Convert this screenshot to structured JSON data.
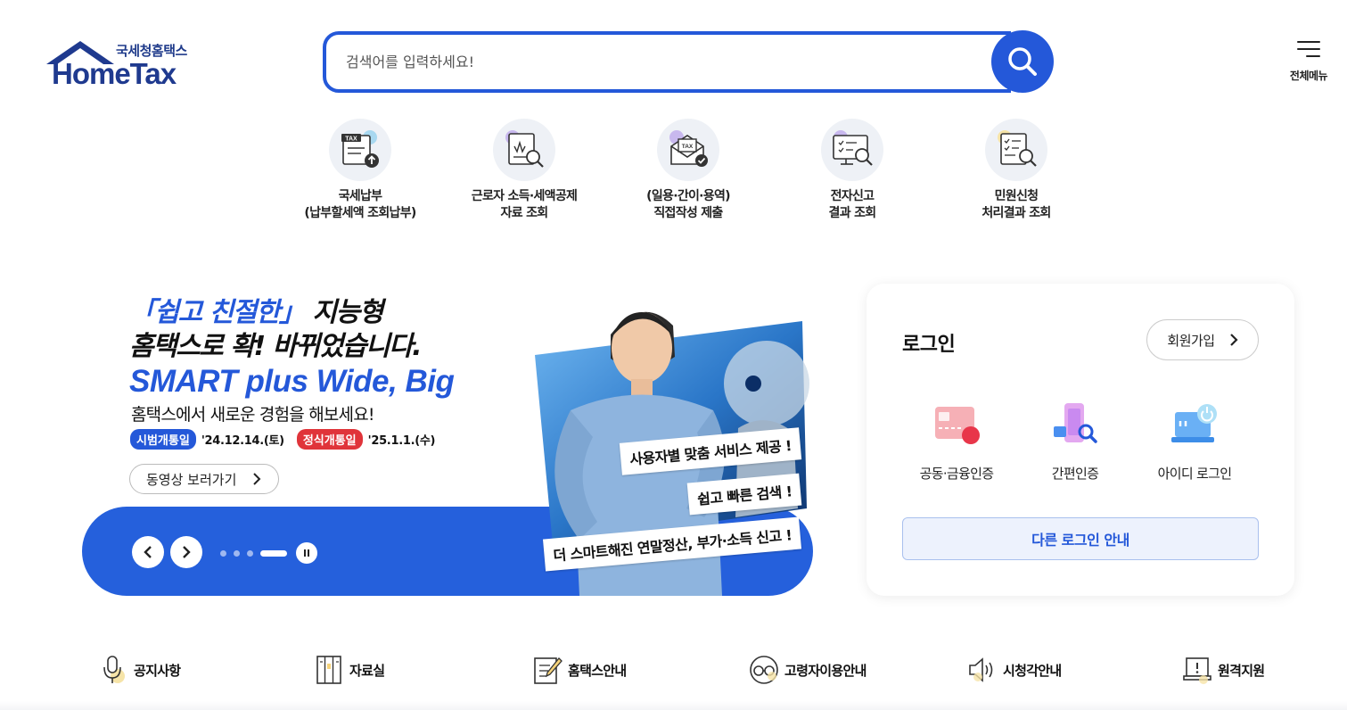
{
  "header": {
    "logo_sub": "국세청홈택스",
    "logo_main": "HomeTax",
    "search_placeholder": "검색어를 입력하세요!",
    "menu_label": "전체메뉴"
  },
  "quick_menu": [
    {
      "line1": "국세납부",
      "line2": "(납부할세액 조회납부)",
      "icon": "tax-payment-icon"
    },
    {
      "line1": "근로자 소득·세액공제",
      "line2": "자료 조회",
      "icon": "income-deduction-icon"
    },
    {
      "line1": "(일용·간이·용역)",
      "line2": "직접작성 제출",
      "icon": "tax-submit-icon"
    },
    {
      "line1": "전자신고",
      "line2": "결과 조회",
      "icon": "e-filing-result-icon"
    },
    {
      "line1": "민원신청",
      "line2": "처리결과 조회",
      "icon": "civil-petition-icon"
    }
  ],
  "banner": {
    "headline_quote": "「쉽고 친절한」",
    "headline_rest": " 지능형",
    "headline_line2": "홈택스로 확! 바뀌었습니다.",
    "subline": "SMART plus Wide, Big",
    "description": "홈택스에서 새로운 경험을 해보세요!",
    "pilot_tag": "시범개통일",
    "pilot_date": "'24.12.14.(토)",
    "official_tag": "정식개통일",
    "official_date": "'25.1.1.(수)",
    "video_button": "동영상 보러가기",
    "captions": [
      "사용자별 맞춤 서비스 제공 !",
      "쉽고 빠른 검색 !",
      "더 스마트해진 연말정산, 부가·소득 신고 !"
    ]
  },
  "login": {
    "title": "로그인",
    "signup": "회원가입",
    "options": [
      {
        "label": "공동·금융인증",
        "icon": "certificate-icon"
      },
      {
        "label": "간편인증",
        "icon": "simple-auth-icon"
      },
      {
        "label": "아이디 로그인",
        "icon": "id-login-icon"
      }
    ],
    "other_login": "다른 로그인 안내"
  },
  "bottom_nav": [
    {
      "label": "공지사항",
      "icon": "microphone-icon"
    },
    {
      "label": "자료실",
      "icon": "archive-icon"
    },
    {
      "label": "홈택스안내",
      "icon": "guide-icon"
    },
    {
      "label": "고령자이용안내",
      "icon": "senior-icon"
    },
    {
      "label": "시청각안내",
      "icon": "audio-visual-icon"
    },
    {
      "label": "원격지원",
      "icon": "remote-support-icon"
    }
  ],
  "colors": {
    "primary": "#2458d9",
    "banner_blue": "#2560dc",
    "red_tag": "#e0343a",
    "login_bg": "#edf2fd"
  }
}
